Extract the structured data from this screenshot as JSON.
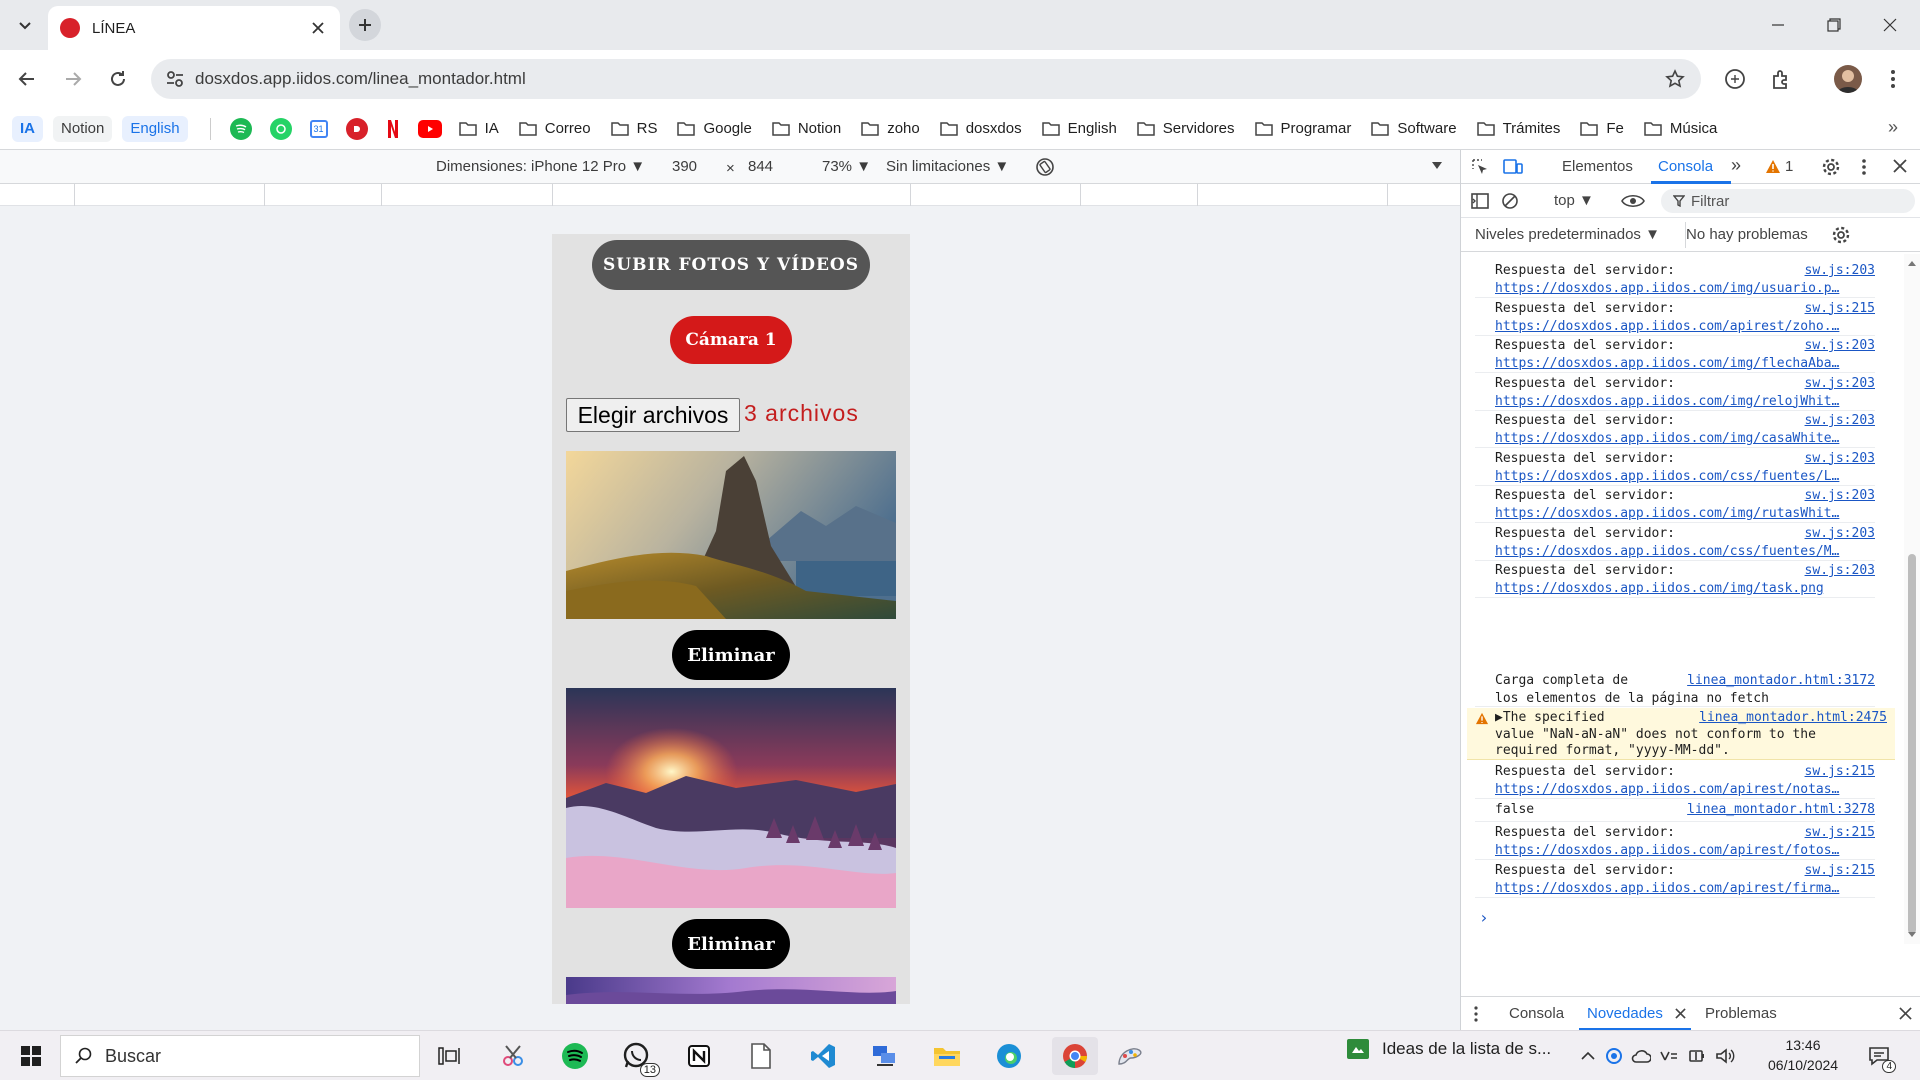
{
  "browser": {
    "tab_title": "LÍNEA",
    "url": "dosxdos.app.iidos.com/linea_montador.html"
  },
  "bookmarks": {
    "pills": [
      "IA",
      "Notion",
      "English"
    ],
    "folders": [
      "IA",
      "Correo",
      "RS",
      "Google",
      "Notion",
      "zoho",
      "dosxdos",
      "English",
      "Servidores",
      "Programar",
      "Software",
      "Trámites",
      "Fe",
      "Música"
    ],
    "apps": [
      "spotify-icon",
      "whatsapp-icon",
      "google-calendar-icon",
      "linea-app-icon",
      "netflix-icon",
      "youtube-icon"
    ],
    "overflow": "»"
  },
  "device_toolbar": {
    "dimensions_label": "Dimensiones: iPhone 12 Pro ▼",
    "width": "390",
    "times": "×",
    "height": "844",
    "zoom": "73% ▼",
    "throttling": "Sin limitaciones ▼"
  },
  "page": {
    "upload_button": "SUBIR FOTOS Y VÍDEOS",
    "camera_button": "Cámara 1",
    "file_button": "Elegir archivos",
    "file_count": "3 archivos",
    "delete_label": "Eliminar"
  },
  "devtools": {
    "tabs": [
      "Elementos",
      "Consola"
    ],
    "active_tab": "Consola",
    "more": "»",
    "warning_count": "1",
    "context": "top ▼",
    "filter_placeholder": "Filtrar",
    "levels": "Niveles predeterminados ▼",
    "issues": "No hay problemas",
    "messages": [
      {
        "text": "Respuesta del servidor:",
        "source": "sw.js:203",
        "url": "https://dosxdos.app.iidos.com/img/usuario.p…"
      },
      {
        "text": "Respuesta del servidor:",
        "source": "sw.js:215",
        "url": "https://dosxdos.app.iidos.com/apirest/zoho.…"
      },
      {
        "text": "Respuesta del servidor:",
        "source": "sw.js:203",
        "url": "https://dosxdos.app.iidos.com/img/flechaAba…"
      },
      {
        "text": "Respuesta del servidor:",
        "source": "sw.js:203",
        "url": "https://dosxdos.app.iidos.com/img/relojWhit…"
      },
      {
        "text": "Respuesta del servidor:",
        "source": "sw.js:203",
        "url": "https://dosxdos.app.iidos.com/img/casaWhite…"
      },
      {
        "text": "Respuesta del servidor:",
        "source": "sw.js:203",
        "url": "https://dosxdos.app.iidos.com/css/fuentes/L…"
      },
      {
        "text": "Respuesta del servidor:",
        "source": "sw.js:203",
        "url": "https://dosxdos.app.iidos.com/img/rutasWhit…"
      },
      {
        "text": "Respuesta del servidor:",
        "source": "sw.js:203",
        "url": "https://dosxdos.app.iidos.com/css/fuentes/M…"
      },
      {
        "text": "Respuesta del servidor:",
        "source": "sw.js:203",
        "url": "https://dosxdos.app.iidos.com/img/task.png"
      }
    ],
    "load_msg": {
      "line1": "Carga completa de",
      "line2": "los elementos de la página no fetch",
      "source": "linea_montador.html:3172"
    },
    "warning_msg": {
      "line1": "▶The specified",
      "line2": "value \"NaN-aN-aN\" does not conform to the",
      "line3": "required format, \"yyyy-MM-dd\".",
      "source": "linea_montador.html:2475"
    },
    "messages2": [
      {
        "text": "Respuesta del servidor:",
        "source": "sw.js:215",
        "url": "https://dosxdos.app.iidos.com/apirest/notas…"
      }
    ],
    "false_msg": {
      "text": "false",
      "source": "linea_montador.html:3278"
    },
    "messages3": [
      {
        "text": "Respuesta del servidor:",
        "source": "sw.js:215",
        "url": "https://dosxdos.app.iidos.com/apirest/fotos…"
      },
      {
        "text": "Respuesta del servidor:",
        "source": "sw.js:215",
        "url": "https://dosxdos.app.iidos.com/apirest/firma…"
      }
    ],
    "prompt": "›",
    "drawer_tabs": [
      "Consola",
      "Novedades",
      "Problemas"
    ],
    "drawer_active": "Novedades"
  },
  "taskbar": {
    "search_placeholder": "Buscar",
    "whatsapp_badge": "13",
    "news": "Ideas de la lista de s...",
    "time": "13:46",
    "date": "06/10/2024",
    "notif_count": "4"
  },
  "colors": {
    "accent": "#1a73e8",
    "brand_red": "#d41919",
    "link": "#1a56c4"
  }
}
